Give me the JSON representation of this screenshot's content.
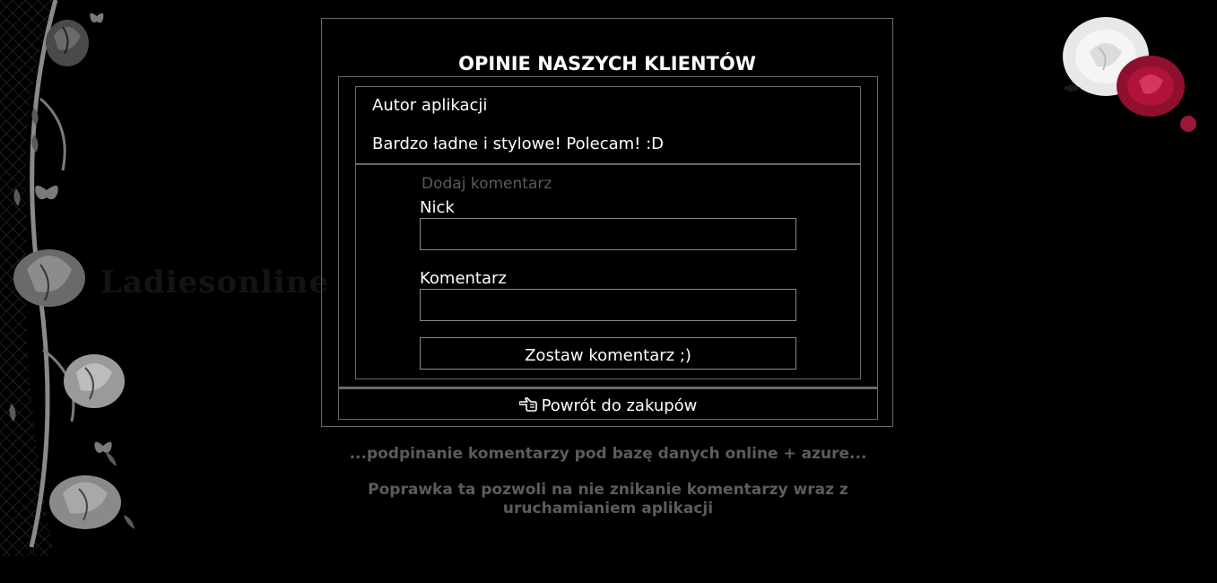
{
  "page": {
    "title": "OPINIE NASZYCH KLIENTÓW",
    "watermark": "Ladiesonline"
  },
  "comments": [
    {
      "author": "Autor aplikacji",
      "text": "Bardzo ładne i stylowe! Polecam! :D"
    }
  ],
  "form": {
    "legend": "Dodaj komentarz",
    "nick_label": "Nick",
    "nick_value": "",
    "comment_label": "Komentarz",
    "comment_value": "",
    "submit_label": "Zostaw komentarz ;)"
  },
  "back": {
    "label": "Powrót do zakupów",
    "icon": "hand-pointing-left-icon"
  },
  "notes": {
    "line1": "...podpinanie komentarzy pod bazę danych online + azure...",
    "line2": "Poprawka ta pozwoli na nie znikanie komentarzy wraz z uruchamianiem aplikacji"
  },
  "colors": {
    "background": "#000000",
    "border": "#6a6a6a",
    "muted_text": "#5c5c5c",
    "rose_white": "#f2f2f2",
    "rose_red": "#b0123a"
  }
}
